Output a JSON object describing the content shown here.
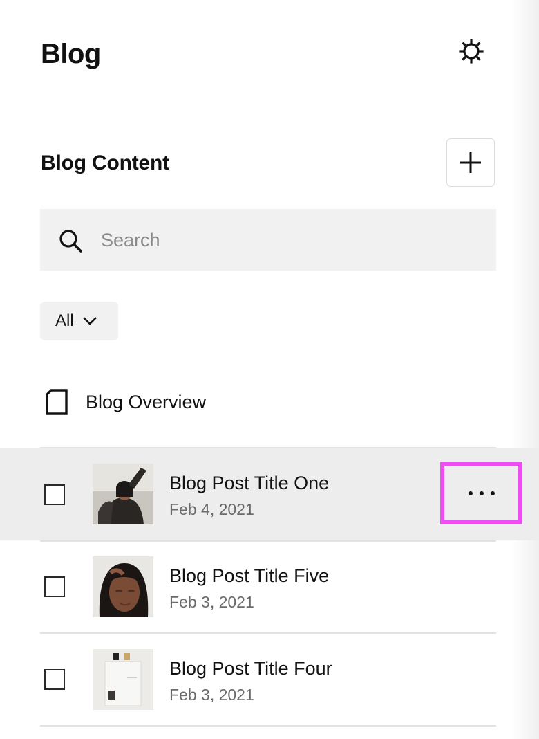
{
  "page": {
    "title": "Blog",
    "settings_icon": "gear-icon"
  },
  "section": {
    "title": "Blog Content",
    "add_icon": "plus-icon"
  },
  "search": {
    "placeholder": "Search",
    "value": "",
    "icon": "search-icon"
  },
  "filter": {
    "label": "All",
    "icon": "chevron-down-icon"
  },
  "overview": {
    "label": "Blog Overview",
    "icon": "page-icon"
  },
  "posts": [
    {
      "title": "Blog Post Title One",
      "date": "Feb 4, 2021",
      "selected": true,
      "checked": false
    },
    {
      "title": "Blog Post Title Five",
      "date": "Feb 3, 2021",
      "selected": false,
      "checked": false
    },
    {
      "title": "Blog Post Title Four",
      "date": "Feb 3, 2021",
      "selected": false,
      "checked": false
    }
  ],
  "more_menu": {
    "icon": "more-horizontal-icon"
  },
  "colors": {
    "highlight": "#ef4cf1",
    "selected_row": "#ededed",
    "search_bg": "#f1f1f1"
  }
}
